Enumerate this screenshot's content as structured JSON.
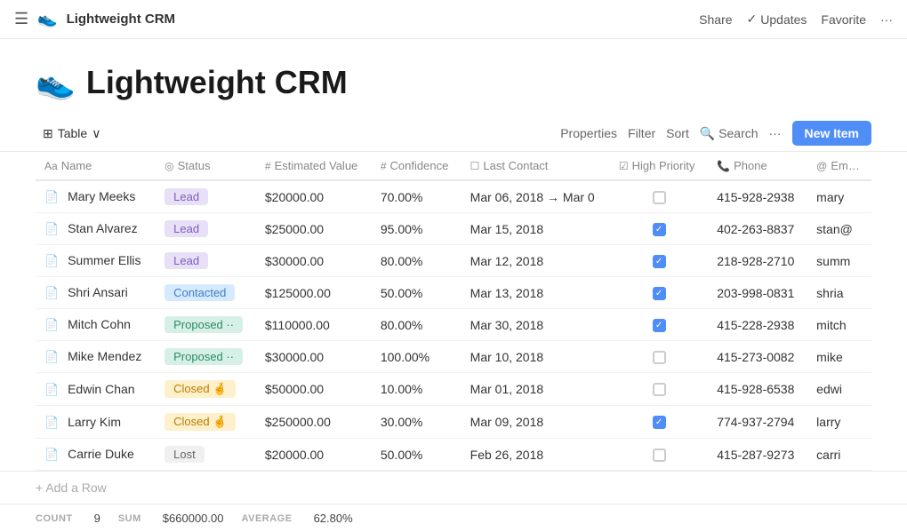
{
  "topnav": {
    "appIcon": "👟",
    "appName": "Lightweight CRM",
    "shareLabel": "Share",
    "updatesLabel": "Updates",
    "favoriteLabel": "Favorite",
    "moreLabel": "···"
  },
  "pageHeader": {
    "icon": "👟",
    "title": "Lightweight CRM"
  },
  "toolbar": {
    "tableViewLabel": "Table",
    "propertiesLabel": "Properties",
    "filterLabel": "Filter",
    "sortLabel": "Sort",
    "searchLabel": "Search",
    "moreLabel": "···",
    "newItemLabel": "New Item"
  },
  "columns": [
    {
      "icon": "Aa",
      "label": "Name"
    },
    {
      "icon": "◎",
      "label": "Status"
    },
    {
      "icon": "#",
      "label": "Estimated Value"
    },
    {
      "icon": "#",
      "label": "Confidence"
    },
    {
      "icon": "☐",
      "label": "Last Contact"
    },
    {
      "icon": "☑",
      "label": "High Priority"
    },
    {
      "icon": "📞",
      "label": "Phone"
    },
    {
      "icon": "@",
      "label": "Em..."
    }
  ],
  "rows": [
    {
      "id": 1,
      "name": "Mary Meeks",
      "status": "Lead",
      "statusType": "lead",
      "estimatedValue": "$20000.00",
      "confidence": "70.00%",
      "lastContact": "Mar 06, 2018 → Mar 0",
      "highPriority": false,
      "phone": "415-928-2938",
      "email": "mary"
    },
    {
      "id": 2,
      "name": "Stan Alvarez",
      "status": "Lead",
      "statusType": "lead",
      "estimatedValue": "$25000.00",
      "confidence": "95.00%",
      "lastContact": "Mar 15, 2018",
      "highPriority": true,
      "phone": "402-263-8837",
      "email": "stan@"
    },
    {
      "id": 3,
      "name": "Summer Ellis",
      "status": "Lead",
      "statusType": "lead",
      "estimatedValue": "$30000.00",
      "confidence": "80.00%",
      "lastContact": "Mar 12, 2018",
      "highPriority": true,
      "phone": "218-928-2710",
      "email": "summ"
    },
    {
      "id": 4,
      "name": "Shri Ansari",
      "status": "Contacted",
      "statusType": "contacted",
      "estimatedValue": "$125000.00",
      "confidence": "50.00%",
      "lastContact": "Mar 13, 2018",
      "highPriority": true,
      "phone": "203-998-0831",
      "email": "shria"
    },
    {
      "id": 5,
      "name": "Mitch Cohn",
      "status": "Proposed ··",
      "statusType": "proposed",
      "estimatedValue": "$110000.00",
      "confidence": "80.00%",
      "lastContact": "Mar 30, 2018",
      "highPriority": true,
      "phone": "415-228-2938",
      "email": "mitch"
    },
    {
      "id": 6,
      "name": "Mike Mendez",
      "status": "Proposed ··",
      "statusType": "proposed",
      "estimatedValue": "$30000.00",
      "confidence": "100.00%",
      "lastContact": "Mar 10, 2018",
      "highPriority": false,
      "phone": "415-273-0082",
      "email": "mike"
    },
    {
      "id": 7,
      "name": "Edwin Chan",
      "status": "Closed 🤞",
      "statusType": "closed",
      "estimatedValue": "$50000.00",
      "confidence": "10.00%",
      "lastContact": "Mar 01, 2018",
      "highPriority": false,
      "phone": "415-928-6538",
      "email": "edwi"
    },
    {
      "id": 8,
      "name": "Larry Kim",
      "status": "Closed 🤞",
      "statusType": "closed",
      "estimatedValue": "$250000.00",
      "confidence": "30.00%",
      "lastContact": "Mar 09, 2018",
      "highPriority": true,
      "phone": "774-937-2794",
      "email": "larry"
    },
    {
      "id": 9,
      "name": "Carrie Duke",
      "status": "Lost",
      "statusType": "lost",
      "estimatedValue": "$20000.00",
      "confidence": "50.00%",
      "lastContact": "Feb 26, 2018",
      "highPriority": false,
      "phone": "415-287-9273",
      "email": "carri"
    }
  ],
  "addRowLabel": "+ Add a Row",
  "summary": {
    "countLabel": "COUNT",
    "countValue": "9",
    "sumLabel": "SUM",
    "sumValue": "$660000.00",
    "avgLabel": "AVERAGE",
    "avgValue": "62.80%"
  }
}
